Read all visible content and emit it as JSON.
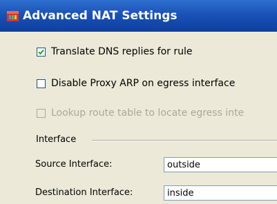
{
  "window": {
    "title": "Advanced NAT Settings"
  },
  "options": [
    {
      "label": "Translate DNS replies for rule",
      "checked": true,
      "enabled": true
    },
    {
      "label": "Disable Proxy ARP on egress interface",
      "checked": false,
      "enabled": true
    },
    {
      "label": "Lookup route table to locate egress inte",
      "checked": false,
      "enabled": false
    }
  ],
  "interface_group": {
    "label": "Interface",
    "source": {
      "label": "Source Interface:",
      "value": "outside"
    },
    "destination": {
      "label": "Destination Interface:",
      "value": "inside"
    }
  },
  "colors": {
    "titlebar": "#1a52b8",
    "panel_bg": "#ece9d8",
    "disabled_text": "#aca899"
  }
}
